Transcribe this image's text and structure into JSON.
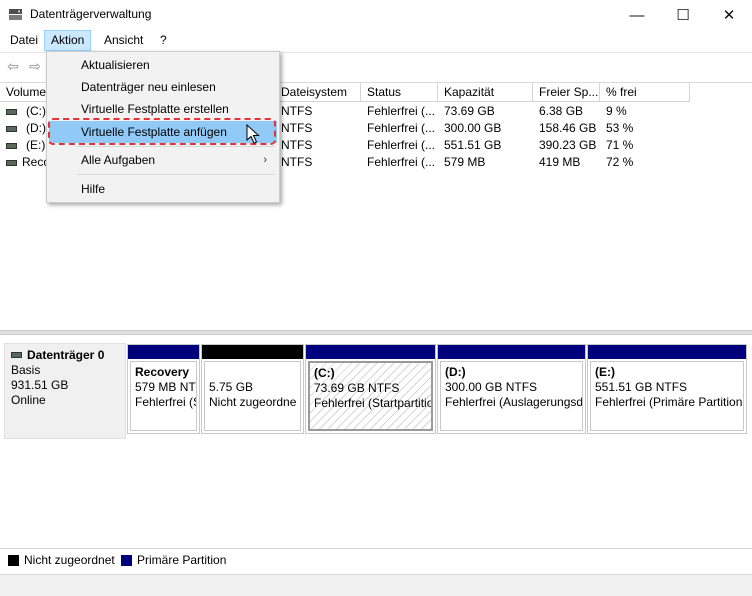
{
  "window": {
    "title": "Datenträgerverwaltung",
    "minimize": "—",
    "maximize": "☐",
    "close": "✕"
  },
  "menubar": {
    "items": [
      "Datei",
      "Aktion",
      "Ansicht",
      "?"
    ]
  },
  "toolbar": {
    "back": "⇦",
    "forward": "⇨"
  },
  "volume_table": {
    "headers": [
      "Volume",
      "Dateisystem",
      "Status",
      "Kapazität",
      "Freier Sp...",
      "% frei"
    ],
    "rows": [
      {
        "name": "(C:)",
        "fs": "NTFS",
        "status": "Fehlerfrei (...",
        "capacity": "73.69 GB",
        "free": "6.38 GB",
        "pct": "9 %"
      },
      {
        "name": "(D:)",
        "fs": "NTFS",
        "status": "Fehlerfrei (...",
        "capacity": "300.00 GB",
        "free": "158.46 GB",
        "pct": "53 %"
      },
      {
        "name": "(E:)",
        "fs": "NTFS",
        "status": "Fehlerfrei (...",
        "capacity": "551.51 GB",
        "free": "390.23 GB",
        "pct": "71 %"
      },
      {
        "name": "Reco",
        "fs": "NTFS",
        "status": "Fehlerfrei (...",
        "capacity": "579 MB",
        "free": "419 MB",
        "pct": "72 %"
      }
    ]
  },
  "action_menu": {
    "items": [
      "Aktualisieren",
      "Datenträger neu einlesen",
      "Virtuelle Festplatte erstellen",
      "Virtuelle Festplatte anfügen",
      "Alle Aufgaben",
      "Hilfe"
    ],
    "submenu_arrow": "›"
  },
  "disk": {
    "name": "Datenträger 0",
    "type": "Basis",
    "size": "931.51 GB",
    "state": "Online"
  },
  "partitions": [
    {
      "title": "Recovery",
      "line1": "579 MB NTFS",
      "line2": "Fehlerfrei (S"
    },
    {
      "title": "",
      "line1": "5.75 GB",
      "line2": "Nicht zugeordne"
    },
    {
      "title": "(C:)",
      "line1": "73.69 GB NTFS",
      "line2": "Fehlerfrei (Startpartitio"
    },
    {
      "title": "(D:)",
      "line1": "300.00 GB NTFS",
      "line2": "Fehlerfrei (Auslagerungsd"
    },
    {
      "title": "(E:)",
      "line1": "551.51 GB NTFS",
      "line2": "Fehlerfrei (Primäre Partition"
    }
  ],
  "legend": {
    "unallocated": "Nicht zugeordnet",
    "primary": "Primäre Partition"
  },
  "colors": {
    "primary_partition": "#00007d",
    "unallocated": "#000000",
    "highlight": "#91c9f7",
    "annotation": "#e53237"
  }
}
